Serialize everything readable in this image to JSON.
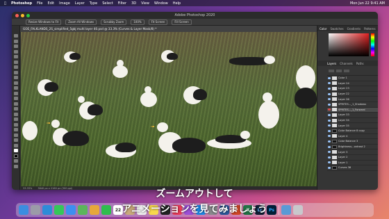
{
  "menubar": {
    "app": "Photoshop",
    "items": [
      "File",
      "Edit",
      "Image",
      "Layer",
      "Type",
      "Select",
      "Filter",
      "3D",
      "View",
      "Window",
      "Help"
    ],
    "right_time": "Mon Jun 22 9:41 AM"
  },
  "window": {
    "title": "Adobe Photoshop 2020"
  },
  "optbar": {
    "items": [
      "Resize Windows to Fit",
      "Zoom All Windows",
      "Scrubby Zoom",
      "100%",
      "Fit Screen",
      "Fill Screen"
    ]
  },
  "document": {
    "tab_label": "GOE_FALKLANDS_2S_simplified_5gbj multi layer 40.psd @ 33.3% (Curves & Layer Mask/8) *",
    "status_zoom": "33.33%",
    "status_size": "3840 px x 2160 px (300 ppi)"
  },
  "panels": {
    "top_tabs": [
      "Color",
      "Swatches",
      "Gradients",
      "Patterns"
    ],
    "layer_tabs": [
      "Layers",
      "Channels",
      "Paths"
    ],
    "layers": [
      {
        "name": "Color 1"
      },
      {
        "name": "Layer 24"
      },
      {
        "name": "Layer 23"
      },
      {
        "name": "Layer 22"
      },
      {
        "name": "Layer 36"
      },
      {
        "name": "SPRITES..._1_Shadows"
      },
      {
        "name": "SPRITES..._1_Forward"
      },
      {
        "name": "Layer 33"
      },
      {
        "name": "Layer 34"
      },
      {
        "name": "Layer 35"
      },
      {
        "name": "Color Balance 8 copy"
      },
      {
        "name": "Layer 4"
      },
      {
        "name": "Color Balance 3"
      },
      {
        "name": "Brightness...ontrast 2"
      },
      {
        "name": "Layer 3"
      },
      {
        "name": "Layer 2"
      },
      {
        "name": "Layer 1"
      },
      {
        "name": "Curves 38"
      }
    ]
  },
  "subtitles": {
    "line1": "ズームアウトして",
    "line2": "アニメーションを見てみましょう"
  },
  "dock": {
    "apps": [
      {
        "name": "finder-icon",
        "color": "#3b8de0"
      },
      {
        "name": "launchpad-icon",
        "color": "#9b9ba8"
      },
      {
        "name": "safari-icon",
        "color": "#2e8bd8"
      },
      {
        "name": "messages-icon",
        "color": "#35c759"
      },
      {
        "name": "mail-icon",
        "color": "#3d8ef0"
      },
      {
        "name": "maps-icon",
        "color": "#5bb55b"
      },
      {
        "name": "photos-icon",
        "color": "#e6a83a"
      },
      {
        "name": "facetime-icon",
        "color": "#2ebd4e"
      },
      {
        "name": "calendar-icon",
        "color": "#ffffff",
        "label": "22"
      },
      {
        "name": "contacts-icon",
        "color": "#c9a97c"
      },
      {
        "name": "reminders-icon",
        "color": "#f0f0f0"
      },
      {
        "name": "notes-icon",
        "color": "#f7d94c"
      },
      {
        "name": "tv-icon",
        "color": "#222222"
      },
      {
        "name": "music-icon",
        "color": "#f03c5a"
      },
      {
        "name": "podcasts-icon",
        "color": "#9b4fd6"
      },
      {
        "name": "appstore-icon",
        "color": "#1f8ef0"
      },
      {
        "name": "settings-icon",
        "color": "#8a8a8e"
      },
      {
        "name": "word-icon",
        "color": "#2b579a",
        "label": "W"
      },
      {
        "name": "powerpoint-icon",
        "color": "#d24726",
        "label": "P"
      },
      {
        "name": "excel-icon",
        "color": "#217346",
        "label": "X"
      },
      {
        "name": "lightroom-icon",
        "color": "#0f1e33",
        "label": "Lr"
      },
      {
        "name": "photoshop-icon",
        "color": "#001e36",
        "label": "Ps"
      },
      {
        "name": "preview-icon",
        "color": "#5a9ad6"
      },
      {
        "name": "trash-icon",
        "color": "#c8c8cc"
      }
    ]
  }
}
